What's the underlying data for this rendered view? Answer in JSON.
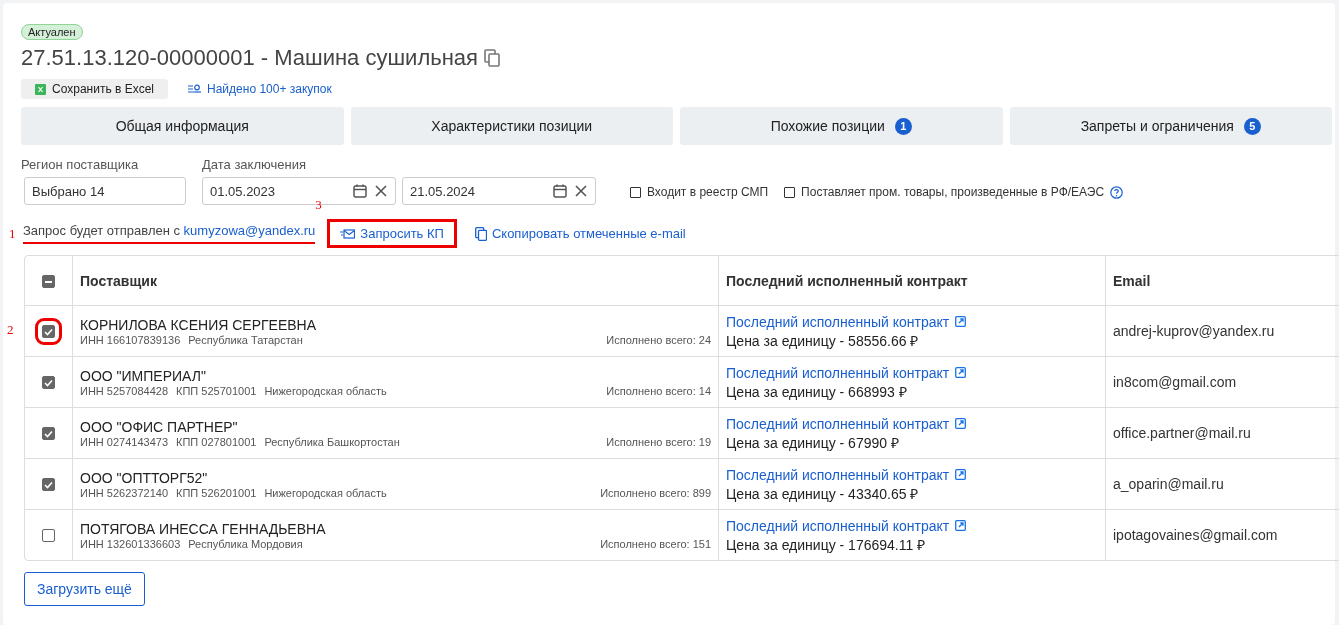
{
  "status_badge": "Актуален",
  "title": "27.51.13.120-00000001 - Машина сушильная",
  "actions": [
    {
      "kind": "excel",
      "label": "Сохранить в Excel"
    },
    {
      "kind": "search",
      "label": "Найдено 100+ закупок"
    }
  ],
  "tabs": [
    {
      "label": "Общая информация",
      "selected": false
    },
    {
      "label": "Характеристики позиции",
      "selected": false
    },
    {
      "label": "Похожие позиции",
      "selected": false,
      "count": "1"
    },
    {
      "label": "Запреты и ограничения",
      "selected": false,
      "count": "5"
    }
  ],
  "filters": {
    "region": {
      "label": "Регион поставщика",
      "value": "Выбрано 14"
    },
    "date": {
      "label": "Дата заключения",
      "from": "01.05.2023",
      "to": "21.05.2024"
    },
    "checkboxes": [
      {
        "label": "Входит в реестр СМП",
        "checked": false,
        "help": false
      },
      {
        "label": "Поставляет пром. товары, произведенные в РФ/ЕАЭС",
        "checked": false,
        "help": true
      }
    ]
  },
  "request": {
    "marker": "1",
    "text": "Запрос будет отправлен с ",
    "email": "kumyzowa@yandex.ru",
    "button": {
      "label": "Запросить КП",
      "marker": "3"
    },
    "copy": "Скопировать отмеченные e-mail"
  },
  "table": {
    "header_checkbox": {
      "indeterminate": true
    },
    "columns": [
      "Поставщик",
      "Последний исполненный контракт",
      "Email"
    ],
    "rows": [
      {
        "checked": true,
        "marker": "2",
        "name": "КОРНИЛОВА КСЕНИЯ СЕРГЕЕВНА",
        "inn": "ИНН 166107839136",
        "kpp": null,
        "region": "Республика Татарстан",
        "done": "Исполнено всего: 24",
        "contract": "Последний исполненный контракт",
        "price": "Цена за единицу - 58556.66 ₽",
        "email": "andrej-kuprov@yandex.ru"
      },
      {
        "checked": true,
        "name": "ООО \"ИМПЕРИАЛ\"",
        "inn": "ИНН 5257084428",
        "kpp": "КПП 525701001",
        "region": "Нижегородская область",
        "done": "Исполнено всего: 14",
        "contract": "Последний исполненный контракт",
        "price": "Цена за единицу - 668993 ₽",
        "email": "in8com@gmail.com"
      },
      {
        "checked": true,
        "name": "ООО \"ОФИС ПАРТНЕР\"",
        "inn": "ИНН 0274143473",
        "kpp": "КПП 027801001",
        "region": "Республика Башкортостан",
        "done": "Исполнено всего: 19",
        "contract": "Последний исполненный контракт",
        "price": "Цена за единицу - 67990 ₽",
        "email": "office.partner@mail.ru"
      },
      {
        "checked": true,
        "name": "ООО \"ОПТТОРГ52\"",
        "inn": "ИНН 5262372140",
        "kpp": "КПП 526201001",
        "region": "Нижегородская область",
        "done": "Исполнено всего: 899",
        "contract": "Последний исполненный контракт",
        "price": "Цена за единицу - 43340.65 ₽",
        "email": "a_oparin@mail.ru"
      },
      {
        "checked": false,
        "name": "ПОТЯГОВА ИНЕССА ГЕННАДЬЕВНА",
        "inn": "ИНН 132601336603",
        "kpp": null,
        "region": "Республика Мордовия",
        "done": "Исполнено всего: 151",
        "contract": "Последний исполненный контракт",
        "price": "Цена за единицу - 176694.11 ₽",
        "email": "ipotagovaines@gmail.com"
      }
    ]
  },
  "load_more": "Загрузить ещё"
}
